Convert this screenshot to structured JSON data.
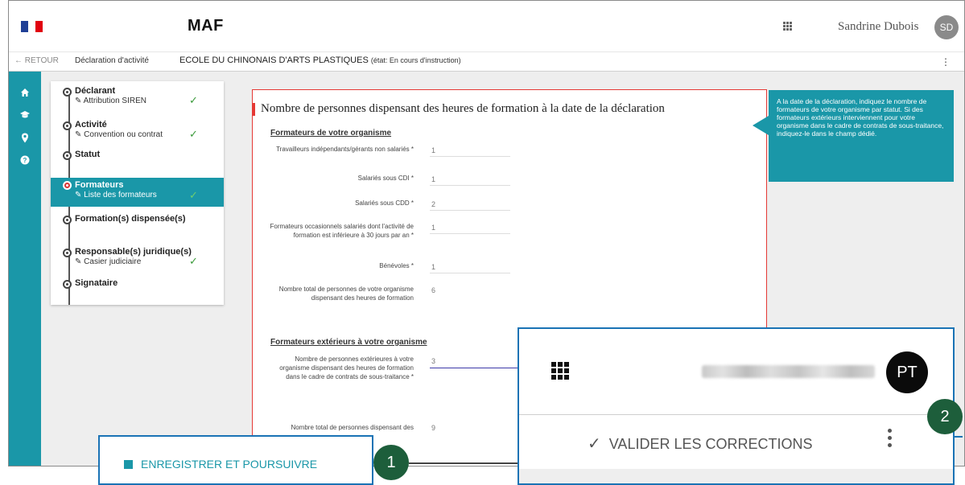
{
  "header": {
    "app_title": "MAF",
    "user_name": "Sandrine Dubois",
    "user_initials": "SD"
  },
  "subheader": {
    "back_label": "← RETOUR",
    "breadcrumb": "Déclaration d'activité",
    "organization": "ECOLE DU CHINONAIS D'ARTS PLASTIQUES",
    "state": "(état: En cours d'instruction)"
  },
  "steps": [
    {
      "title": "Déclarant",
      "sub": "✎ Attribution SIREN",
      "done": true
    },
    {
      "title": "Activité",
      "sub": "✎ Convention ou contrat",
      "done": true
    },
    {
      "title": "Statut",
      "sub": "",
      "done": false
    },
    {
      "title": "Formateurs",
      "sub": "✎ Liste des formateurs",
      "done": true
    },
    {
      "title": "Formation(s) dispensée(s)",
      "sub": "",
      "done": false
    },
    {
      "title": "Responsable(s) juridique(s)",
      "sub": "✎ Casier judiciaire",
      "done": true
    },
    {
      "title": "Signataire",
      "sub": "",
      "done": false
    }
  ],
  "form": {
    "title": "Nombre de personnes dispensant des heures de formation à la date de la déclaration",
    "section1": "Formateurs de votre organisme",
    "section2": "Formateurs extérieurs à votre organisme",
    "fields": [
      {
        "label": "Travailleurs indépendants/gérants non salariés *",
        "value": "1"
      },
      {
        "label": "Salariés sous CDI *",
        "value": "1"
      },
      {
        "label": "Salariés sous CDD *",
        "value": "2"
      },
      {
        "label": "Formateurs occasionnels salariés dont l'activité de formation est inférieure à 30 jours par an *",
        "value": "1"
      },
      {
        "label": "Bénévoles *",
        "value": "1"
      },
      {
        "label": "Nombre total de personnes de votre organisme dispensant des heures de formation",
        "value": "6"
      },
      {
        "label": "Nombre de personnes extérieures à votre organisme dispensant des heures de formation dans le cadre de contrats de sous-traitance *",
        "value": "3"
      },
      {
        "label": "Nombre total de personnes dispensant des",
        "value": "9"
      }
    ]
  },
  "tooltip": {
    "text": "A la date de la déclaration, indiquez le nombre de formateurs de votre organisme par statut. Si des formateurs extérieurs interviennent pour votre organisme dans le cadre de contrats de sous-traitance, indiquez-le dans le champ dédié."
  },
  "zoom_right": {
    "avatar_initials": "PT",
    "validate_label": "VALIDER LES CORRECTIONS",
    "check_glyph": "✓"
  },
  "zoom_left": {
    "save_label": "ENREGISTRER ET POURSUIVRE"
  },
  "callouts": {
    "one": "1",
    "two": "2"
  },
  "colors": {
    "teal": "#1a97a8",
    "callout_green": "#1d5e3b",
    "zoom_border": "#1a73b5",
    "error_red": "#e53935"
  }
}
